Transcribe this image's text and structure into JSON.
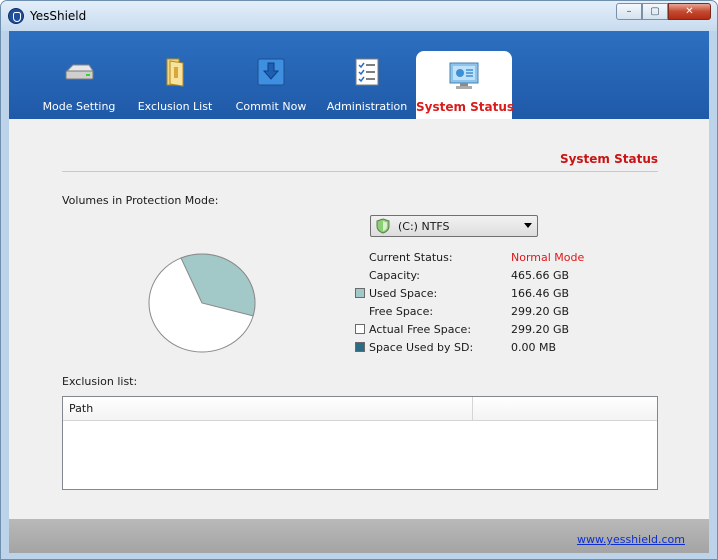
{
  "window": {
    "title": "YesShield",
    "minimize_glyph": "–",
    "maximize_glyph": "▢",
    "close_glyph": "✕"
  },
  "tabs": [
    {
      "label": "Mode Setting",
      "icon": "drive-icon"
    },
    {
      "label": "Exclusion List",
      "icon": "folder-icon"
    },
    {
      "label": "Commit Now",
      "icon": "commit-arrow-icon"
    },
    {
      "label": "Administration",
      "icon": "checklist-icon"
    },
    {
      "label": "System Status",
      "icon": "monitor-status-icon",
      "active": true
    }
  ],
  "section_title": "System Status",
  "volumes_label": "Volumes in Protection Mode:",
  "volume_select": {
    "value": "(C:) NTFS"
  },
  "status": [
    {
      "label": "Current Status:",
      "value": "Normal Mode"
    },
    {
      "label": "Capacity:",
      "value": "465.66 GB"
    },
    {
      "label": "Used Space:",
      "value": "166.46 GB"
    },
    {
      "label": "Free Space:",
      "value": "299.20 GB"
    },
    {
      "label": "Actual Free Space:",
      "value": "299.20 GB"
    },
    {
      "label": "Space Used by SD:",
      "value": "0.00 MB"
    }
  ],
  "chart_data": {
    "type": "pie",
    "slices": [
      {
        "label": "Used Space",
        "value": 166.46,
        "color": "#a3c8c8"
      },
      {
        "label": "Actual Free Space",
        "value": 299.2,
        "color": "#ffffff"
      },
      {
        "label": "Space Used by SD",
        "value": 0.0,
        "color": "#2c6b84"
      }
    ]
  },
  "colors": {
    "status_red": "#e0181a",
    "used": "#a3c8c8",
    "free": "#ffffff",
    "sd": "#2c6b84",
    "tab_blue": "#2563b4"
  },
  "exclusion_label": "Exclusion list:",
  "exclusion_table": {
    "columns": [
      "Path",
      ""
    ],
    "rows": []
  },
  "footer": {
    "link": "www.yesshield.com"
  }
}
